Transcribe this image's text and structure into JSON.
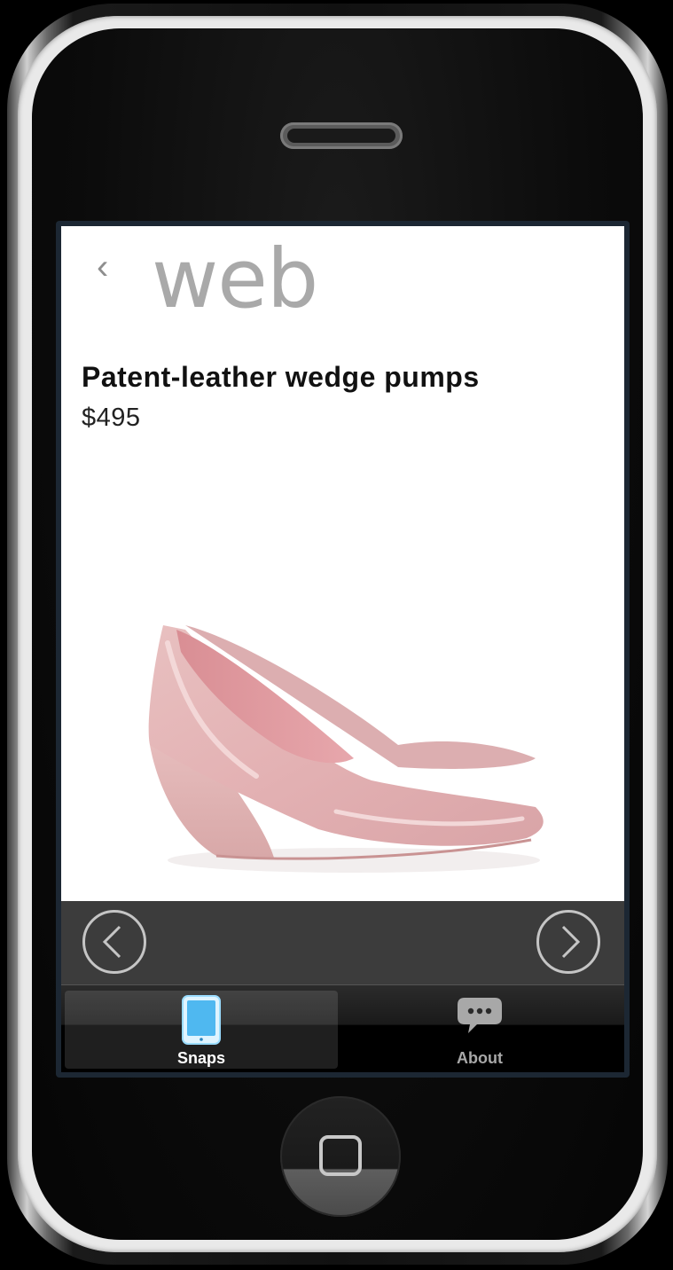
{
  "app": {
    "back_glyph": "‹",
    "title": "web"
  },
  "product": {
    "name": "Patent-leather wedge pumps",
    "price": "$495",
    "image_icon": "pink-wedge-pump-image",
    "image_color": "#e3b3b3"
  },
  "pager": {
    "prev_icon": "chevron-left-circle-icon",
    "next_icon": "chevron-right-circle-icon"
  },
  "tabs": [
    {
      "label": "Snaps",
      "icon": "tablet-icon",
      "active": true
    },
    {
      "label": "About",
      "icon": "speech-bubble-icon",
      "active": false
    }
  ],
  "colors": {
    "screen_bg": "#ffffff",
    "pager_bg": "#3c3c3c",
    "title_gray": "#a9a9a9",
    "tab_active_icon": "#5fc6ff"
  }
}
